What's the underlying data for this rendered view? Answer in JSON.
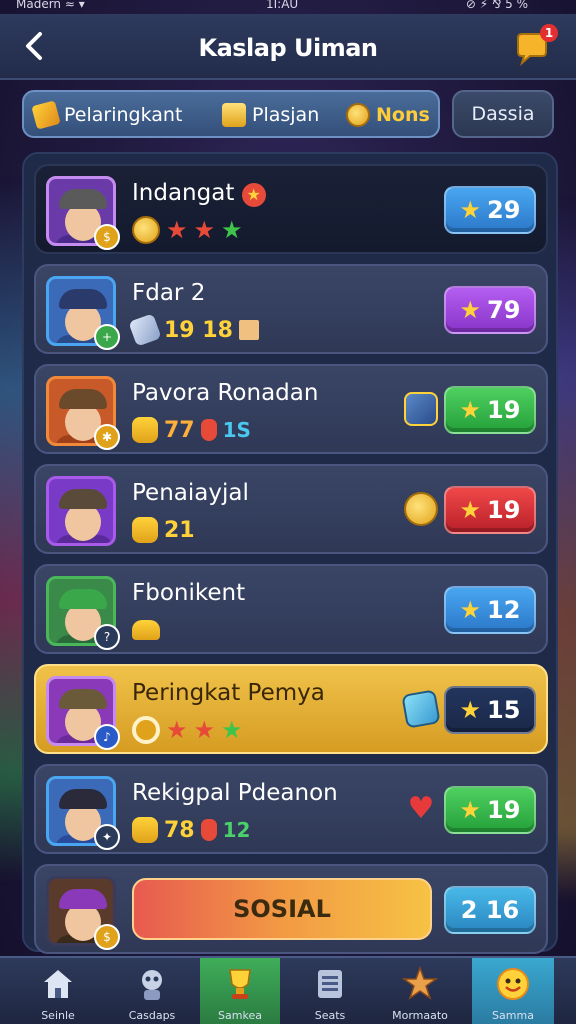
{
  "status_bar": {
    "left": "Madern ≈ ▾",
    "center": "1I:AU",
    "right": "⊘ ⚡ ⅋ 5 %"
  },
  "header": {
    "title": "Kaslap Uiman",
    "notification_count": "1"
  },
  "tabs": {
    "items": [
      {
        "label": "Pelaringkant",
        "color": "#f0b030"
      },
      {
        "label": "Plasjan",
        "color": "#f6c83a"
      },
      {
        "label": "Nons",
        "color": "#ffcd3a"
      }
    ],
    "extra": "Dassia"
  },
  "rows": [
    {
      "name": "Indangat",
      "sub_value": "",
      "stars": [
        "#e84a3a",
        "#e84a3a",
        "#3fc44a"
      ],
      "score": "29",
      "badge_color": "blue",
      "avatar_border": "#c58cf0",
      "hat_color": "#5a5a5a",
      "shirt_color": "#6a3aa8"
    },
    {
      "name": "Fdar 2",
      "sub_value": "19 18",
      "stars": [],
      "score": "79",
      "badge_color": "purple",
      "avatar_border": "#4aa6f0",
      "hat_color": "#2a3a6a",
      "shirt_color": "#2a4a8a"
    },
    {
      "name": "Pavora Ronadan",
      "sub_value": "77",
      "sub_value2": "1S",
      "stars": [],
      "score": "19",
      "badge_color": "green",
      "avatar_border": "#f08a3a",
      "hat_color": "#6a4a2a",
      "shirt_color": "#a0401a"
    },
    {
      "name": "Penaiayjal",
      "sub_value": "21",
      "stars": [],
      "score": "19",
      "badge_color": "red",
      "avatar_border": "#a85ae8",
      "hat_color": "#5a4a3a",
      "shirt_color": "#7a4ac8"
    },
    {
      "name": "Fbonikent",
      "sub_value": "",
      "stars": [],
      "score": "12",
      "badge_color": "blue",
      "avatar_border": "#4ab85a",
      "hat_color": "#3aa84a",
      "shirt_color": "#3a7a3a"
    },
    {
      "name": "Peringkat Pemya",
      "sub_value": "",
      "stars": [
        "#e84a3a",
        "#e84a3a",
        "#3fc44a"
      ],
      "score": "15",
      "badge_color": "navy",
      "avatar_border": "#c58cf0",
      "hat_color": "#6a5a3a",
      "shirt_color": "#8a3ab8"
    },
    {
      "name": "Rekigpal Pdeanon",
      "sub_value": "78",
      "sub_value2": "12",
      "stars": [],
      "score": "19",
      "badge_color": "green",
      "avatar_border": "#4aa6f0",
      "hat_color": "#2a2a3a",
      "shirt_color": "#2a4a9a"
    }
  ],
  "last_row": {
    "button_label": "SOSIAL",
    "score": "2 16"
  },
  "bottom_nav": [
    {
      "label": "Seinle"
    },
    {
      "label": "Casdaps"
    },
    {
      "label": "Samkea"
    },
    {
      "label": "Seats"
    },
    {
      "label": "Mormaato"
    },
    {
      "label": "Samma"
    }
  ]
}
